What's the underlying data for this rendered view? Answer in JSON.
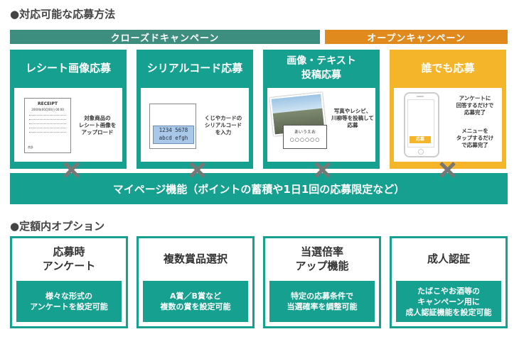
{
  "section1": {
    "title": "●対応可能な応募方法"
  },
  "bands": {
    "closed": "クローズドキャンペーン",
    "open": "オープンキャンペーン"
  },
  "colors": {
    "teal": "#16a08f",
    "teal_band": "#3e8e7f",
    "orange": "#f5a623",
    "orange_band": "#e08a1e",
    "gray_x": "#777777"
  },
  "cards": [
    {
      "title": "レシート画像応募",
      "receipt_header": "RECEIPT",
      "receipt_sub": "20XX年00月00日 00:00",
      "receipt_total": "合計",
      "desc": "対象商品の\nレシート画像を\nアップロード"
    },
    {
      "title": "シリアルコード応募",
      "code_line1": "1234 5678",
      "code_line2": "abcd efgh",
      "desc": "くじやカードの\nシリアルコード\nを入力"
    },
    {
      "title": "画像・テキスト\n投稿応募",
      "note_text": "あいうえお",
      "note_circles": "○○○○○○",
      "desc": "写真やレシピ、\n川柳等を投稿して\n応募"
    },
    {
      "title": "誰でも応募",
      "phone_button": "応募",
      "desc1": "アンケートに\n回答するだけで\n応募完了",
      "desc2": "メニューを\nタップするだけ\nで応募完了"
    }
  ],
  "mypage": {
    "label": "マイページ機能（ポイントの蓄積や1日1回の応募限定など）"
  },
  "section2": {
    "title": "●定額内オプション"
  },
  "options": [
    {
      "title": "応募時\nアンケート",
      "desc": "様々な形式の\nアンケートを設定可能"
    },
    {
      "title": "複数賞品選択",
      "desc": "A賞／B賞など\n複数の賞を設定可能"
    },
    {
      "title": "当選倍率\nアップ機能",
      "desc": "特定の応募条件で\n当選確率を調整可能"
    },
    {
      "title": "成人認証",
      "desc": "たばこやお酒等の\nキャンペーン用に\n成人認証機能を設定可能"
    }
  ]
}
